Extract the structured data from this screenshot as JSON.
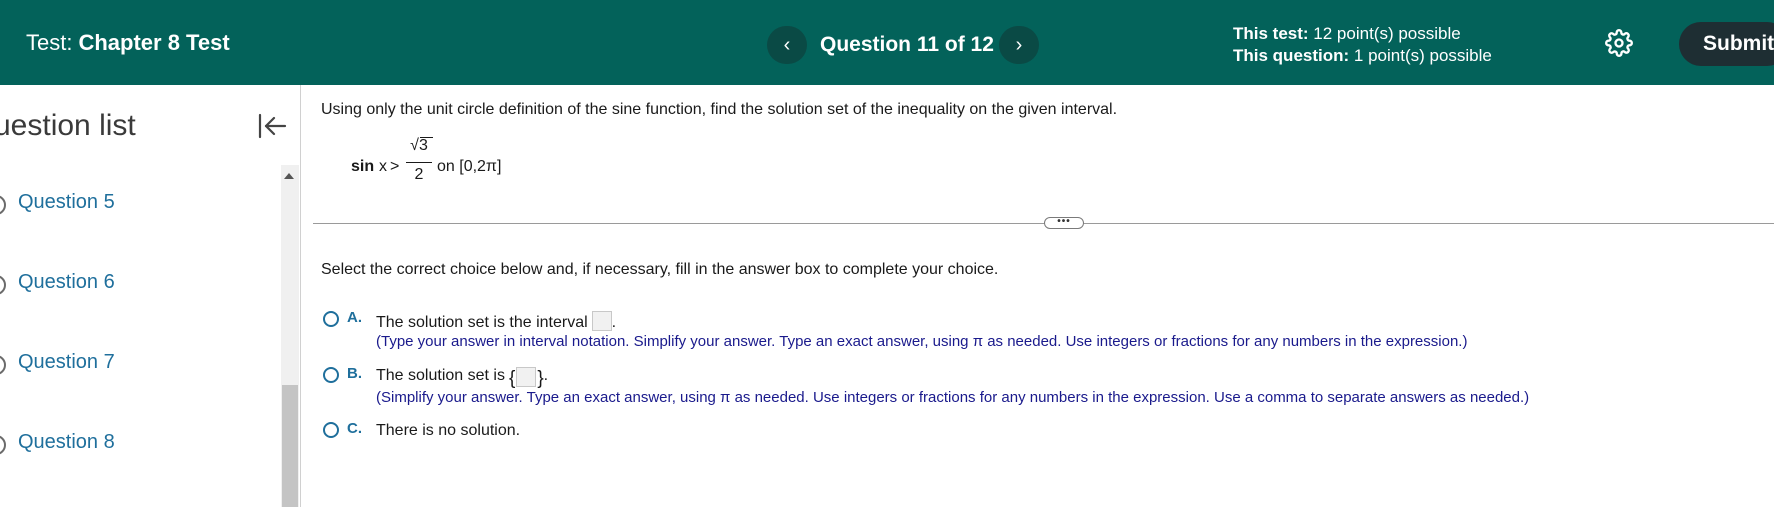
{
  "header": {
    "test_prefix": "Test:",
    "test_name": "Chapter 8 Test",
    "prev_glyph": "‹",
    "next_glyph": "›",
    "question_counter": "Question 11 of 12",
    "this_test_label": "This test:",
    "this_test_value": "12 point(s) possible",
    "this_question_label": "This question:",
    "this_question_value": "1 point(s) possible",
    "settings_icon": "gear-icon",
    "submit_label": "Submit"
  },
  "sidebar": {
    "title": "uestion list",
    "collapse_icon": "collapse-left-icon",
    "items": [
      {
        "label": "Question 5"
      },
      {
        "label": "Question 6"
      },
      {
        "label": "Question 7"
      },
      {
        "label": "Question 8"
      }
    ]
  },
  "question": {
    "instruction": "Using only the unit circle definition of the sine function, find the solution set of the inequality on the given interval.",
    "expr_fn": "sin",
    "expr_var": "x",
    "expr_op": ">",
    "expr_num": "√3",
    "expr_den": "2",
    "expr_interval": "on [0,2π]",
    "divider_handle": "•••",
    "select_prompt": "Select the correct choice below and, if necessary, fill in the answer box to complete your choice.",
    "choices": [
      {
        "letter": "A.",
        "text": "The solution set is the interval",
        "suffix": ".",
        "hint": "(Type your answer in interval notation. Simplify your answer. Type an exact answer, using π as needed. Use integers or fractions for any numbers in the expression.)"
      },
      {
        "letter": "B.",
        "text": "The solution set is",
        "brace_open": "{",
        "brace_close": "}",
        "suffix": ".",
        "hint": "(Simplify your answer. Type an exact answer, using π as needed. Use integers or fractions for any numbers in the expression. Use a comma to separate answers as needed.)"
      },
      {
        "letter": "C.",
        "text": "There is no solution."
      }
    ]
  },
  "colors": {
    "header_bg": "#03625a",
    "accent": "#1f6f9c",
    "hint_text": "#1a1a8c",
    "submit_bg": "#1e2e33"
  }
}
